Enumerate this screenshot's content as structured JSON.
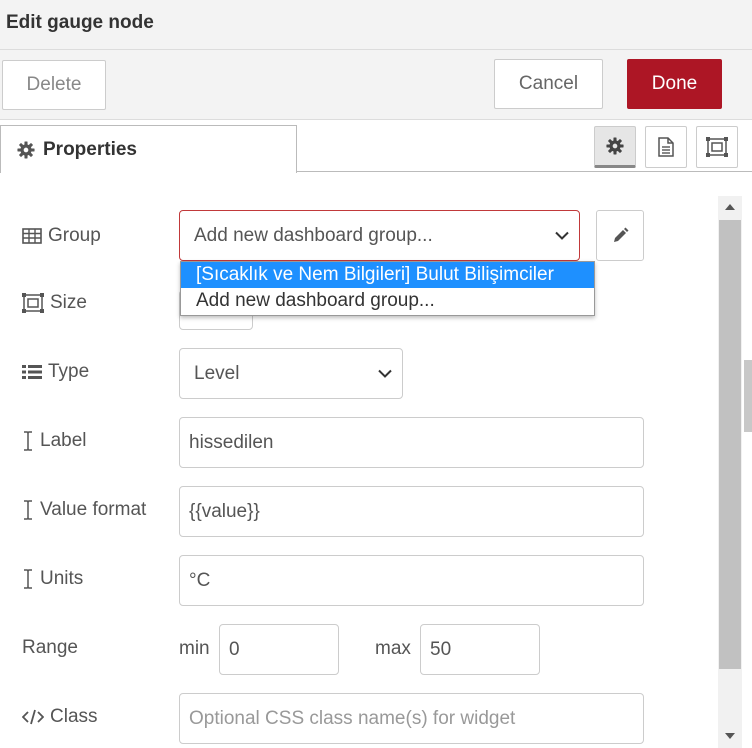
{
  "title": "Edit gauge node",
  "toolbar": {
    "delete_label": "Delete",
    "cancel_label": "Cancel",
    "done_label": "Done"
  },
  "tabs": {
    "properties_label": "Properties"
  },
  "form": {
    "group": {
      "label": "Group",
      "value": "Add new dashboard group..."
    },
    "group_dropdown": {
      "options": [
        "[Sıcaklık ve Nem Bilgileri] Bulut Bilişimciler",
        "Add new dashboard group..."
      ]
    },
    "size": {
      "label": "Size"
    },
    "type": {
      "label": "Type",
      "value": "Level"
    },
    "label": {
      "label": "Label",
      "value": "hissedilen"
    },
    "value_format": {
      "label": "Value format",
      "value": "{{value}}"
    },
    "units": {
      "label": "Units",
      "value": "°C"
    },
    "range": {
      "label": "Range",
      "min_label": "min",
      "min_value": "0",
      "max_label": "max",
      "max_value": "50"
    },
    "class": {
      "label": "Class",
      "placeholder": "Optional CSS class name(s) for widget"
    }
  },
  "colors": {
    "done": "#ad1625",
    "selected_option": "#1e90ff",
    "error_border": "#c1393a"
  }
}
